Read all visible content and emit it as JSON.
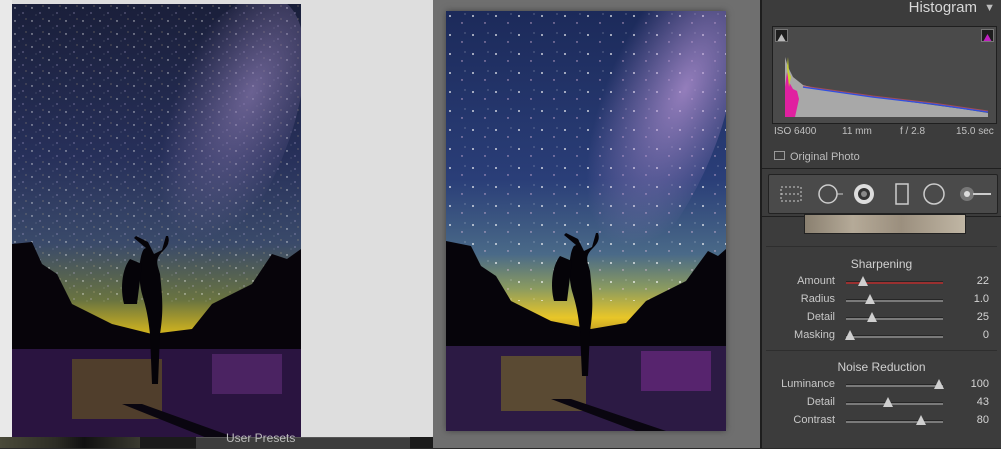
{
  "histogram": {
    "title": "Histogram",
    "exif": {
      "iso": "ISO 6400",
      "focal_length": "11 mm",
      "aperture": "f / 2.8",
      "shutter": "15.0 sec"
    },
    "original_photo_label": "Original Photo",
    "clip_shadow_color": "#222222",
    "clip_highlight_color": "#c020c0"
  },
  "tools": [
    "crop-overlay-icon",
    "spot-removal-icon",
    "red-eye-icon",
    "graduated-filter-icon",
    "radial-filter-icon",
    "adjustment-brush-icon"
  ],
  "sharpening": {
    "title": "Sharpening",
    "sliders": [
      {
        "label": "Amount",
        "value": "22",
        "level": 0.147
      },
      {
        "label": "Radius",
        "value": "1.0",
        "level": 0.222
      },
      {
        "label": "Detail",
        "value": "25",
        "level": 0.25
      },
      {
        "label": "Masking",
        "value": "0",
        "level": 0.0
      }
    ]
  },
  "noise_reduction": {
    "title": "Noise Reduction",
    "sliders": [
      {
        "label": "Luminance",
        "value": "100",
        "level": 1.0
      },
      {
        "label": "Detail",
        "value": "43",
        "level": 0.43
      },
      {
        "label": "Contrast",
        "value": "80",
        "level": 0.8
      }
    ]
  },
  "user_presets_label": "User Presets",
  "colors": {
    "panel_bg": "#3c3c3c",
    "accent_clip": "#c020c0",
    "sharpen_track": "#9a3030"
  }
}
